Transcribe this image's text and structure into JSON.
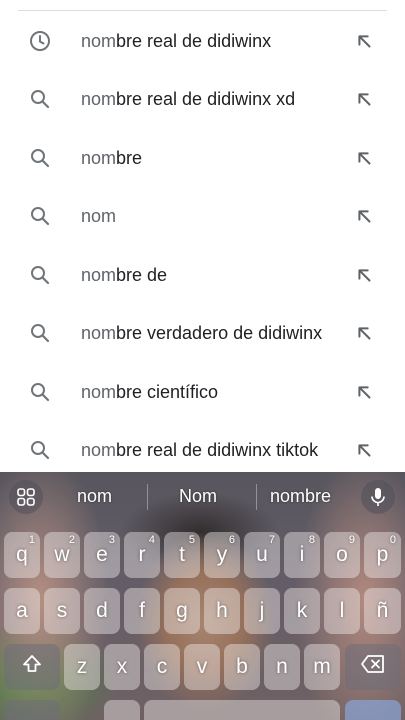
{
  "suggestions": [
    {
      "icon": "history-icon",
      "typed": "nom",
      "rest": "bre real de didiwinx"
    },
    {
      "icon": "search-icon",
      "typed": "nom",
      "rest": "bre real de didiwinx xd"
    },
    {
      "icon": "search-icon",
      "typed": "nom",
      "rest": "bre"
    },
    {
      "icon": "search-icon",
      "typed": "nom",
      "rest": ""
    },
    {
      "icon": "search-icon",
      "typed": "nom",
      "rest": "bre de"
    },
    {
      "icon": "search-icon",
      "typed": "nom",
      "rest": "bre verdadero de didiwinx"
    },
    {
      "icon": "search-icon",
      "typed": "nom",
      "rest": "bre científico"
    },
    {
      "icon": "search-icon",
      "typed": "nom",
      "rest": "bre real de didiwinx tiktok"
    }
  ],
  "keyboard": {
    "suggestion_words": [
      "nom",
      "Nom",
      "nombre"
    ],
    "row1": [
      {
        "k": "q",
        "h": "1"
      },
      {
        "k": "w",
        "h": "2"
      },
      {
        "k": "e",
        "h": "3"
      },
      {
        "k": "r",
        "h": "4"
      },
      {
        "k": "t",
        "h": "5"
      },
      {
        "k": "y",
        "h": "6"
      },
      {
        "k": "u",
        "h": "7"
      },
      {
        "k": "i",
        "h": "8"
      },
      {
        "k": "o",
        "h": "9"
      },
      {
        "k": "p",
        "h": "0"
      }
    ],
    "row2": [
      "a",
      "s",
      "d",
      "f",
      "g",
      "h",
      "j",
      "k",
      "l",
      "ñ"
    ],
    "row3": [
      "z",
      "x",
      "c",
      "v",
      "b",
      "n",
      "m"
    ]
  },
  "colors": {
    "text": "#202124",
    "typed": "#5f6368",
    "icon": "#70757a"
  }
}
